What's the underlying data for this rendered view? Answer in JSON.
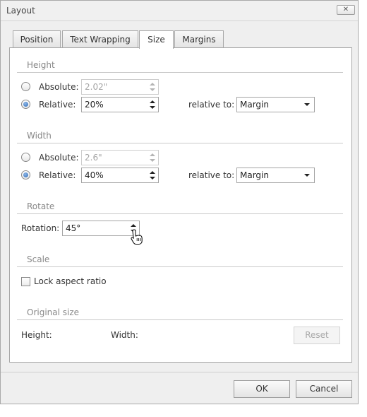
{
  "window": {
    "title": "Layout",
    "close_icon": "close-icon"
  },
  "tabs": [
    {
      "label": "Position",
      "active": false
    },
    {
      "label": "Text Wrapping",
      "active": false
    },
    {
      "label": "Size",
      "active": true
    },
    {
      "label": "Margins",
      "active": false
    }
  ],
  "height": {
    "section_title": "Height",
    "absolute_label": "Absolute:",
    "absolute_value": "2.02\"",
    "relative_label": "Relative:",
    "relative_value": "20%",
    "relative_to_label": "relative to:",
    "relative_to_value": "Margin",
    "selected": "relative"
  },
  "width": {
    "section_title": "Width",
    "absolute_label": "Absolute:",
    "absolute_value": "2.6\"",
    "relative_label": "Relative:",
    "relative_value": "40%",
    "relative_to_label": "relative to:",
    "relative_to_value": "Margin",
    "selected": "relative"
  },
  "rotate": {
    "section_title": "Rotate",
    "rotation_label": "Rotation:",
    "rotation_value": "45°"
  },
  "scale": {
    "section_title": "Scale",
    "lock_label": "Lock aspect ratio",
    "lock_checked": false
  },
  "original_size": {
    "section_title": "Original size",
    "height_label": "Height:",
    "width_label": "Width:",
    "reset_label": "Reset"
  },
  "footer": {
    "ok_label": "OK",
    "cancel_label": "Cancel"
  },
  "colors": {
    "accent": "#2f6ab5",
    "section_text": "#888888",
    "disabled_text": "#a5a5a5"
  }
}
